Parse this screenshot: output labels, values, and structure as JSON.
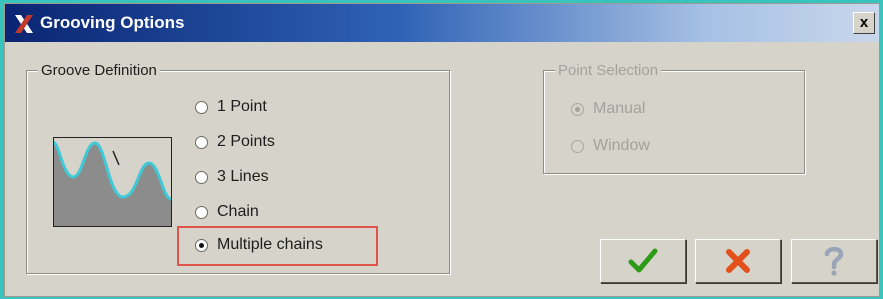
{
  "window": {
    "title": "Grooving Options",
    "icon": "app-x-logo-icon",
    "close_label": "x"
  },
  "groove_definition": {
    "legend": "Groove Definition",
    "options": [
      {
        "label": "1 Point",
        "selected": false
      },
      {
        "label": "2 Points",
        "selected": false
      },
      {
        "label": "3 Lines",
        "selected": false
      },
      {
        "label": "Chain",
        "selected": false
      },
      {
        "label": "Multiple chains",
        "selected": true
      }
    ]
  },
  "point_selection": {
    "legend": "Point Selection",
    "enabled": false,
    "options": [
      {
        "label": "Manual",
        "selected": true
      },
      {
        "label": "Window",
        "selected": false
      }
    ]
  },
  "buttons": {
    "ok_icon": "checkmark-icon",
    "cancel_icon": "x-cancel-icon",
    "help_icon": "question-mark-icon"
  },
  "colors": {
    "titlebar_start": "#0a2572",
    "titlebar_end": "#c9d7ec",
    "highlight": "#e0554a",
    "ok_green": "#2e9a1a",
    "cancel_red": "#e2501c",
    "groove_profile": "#3fc9d6"
  }
}
